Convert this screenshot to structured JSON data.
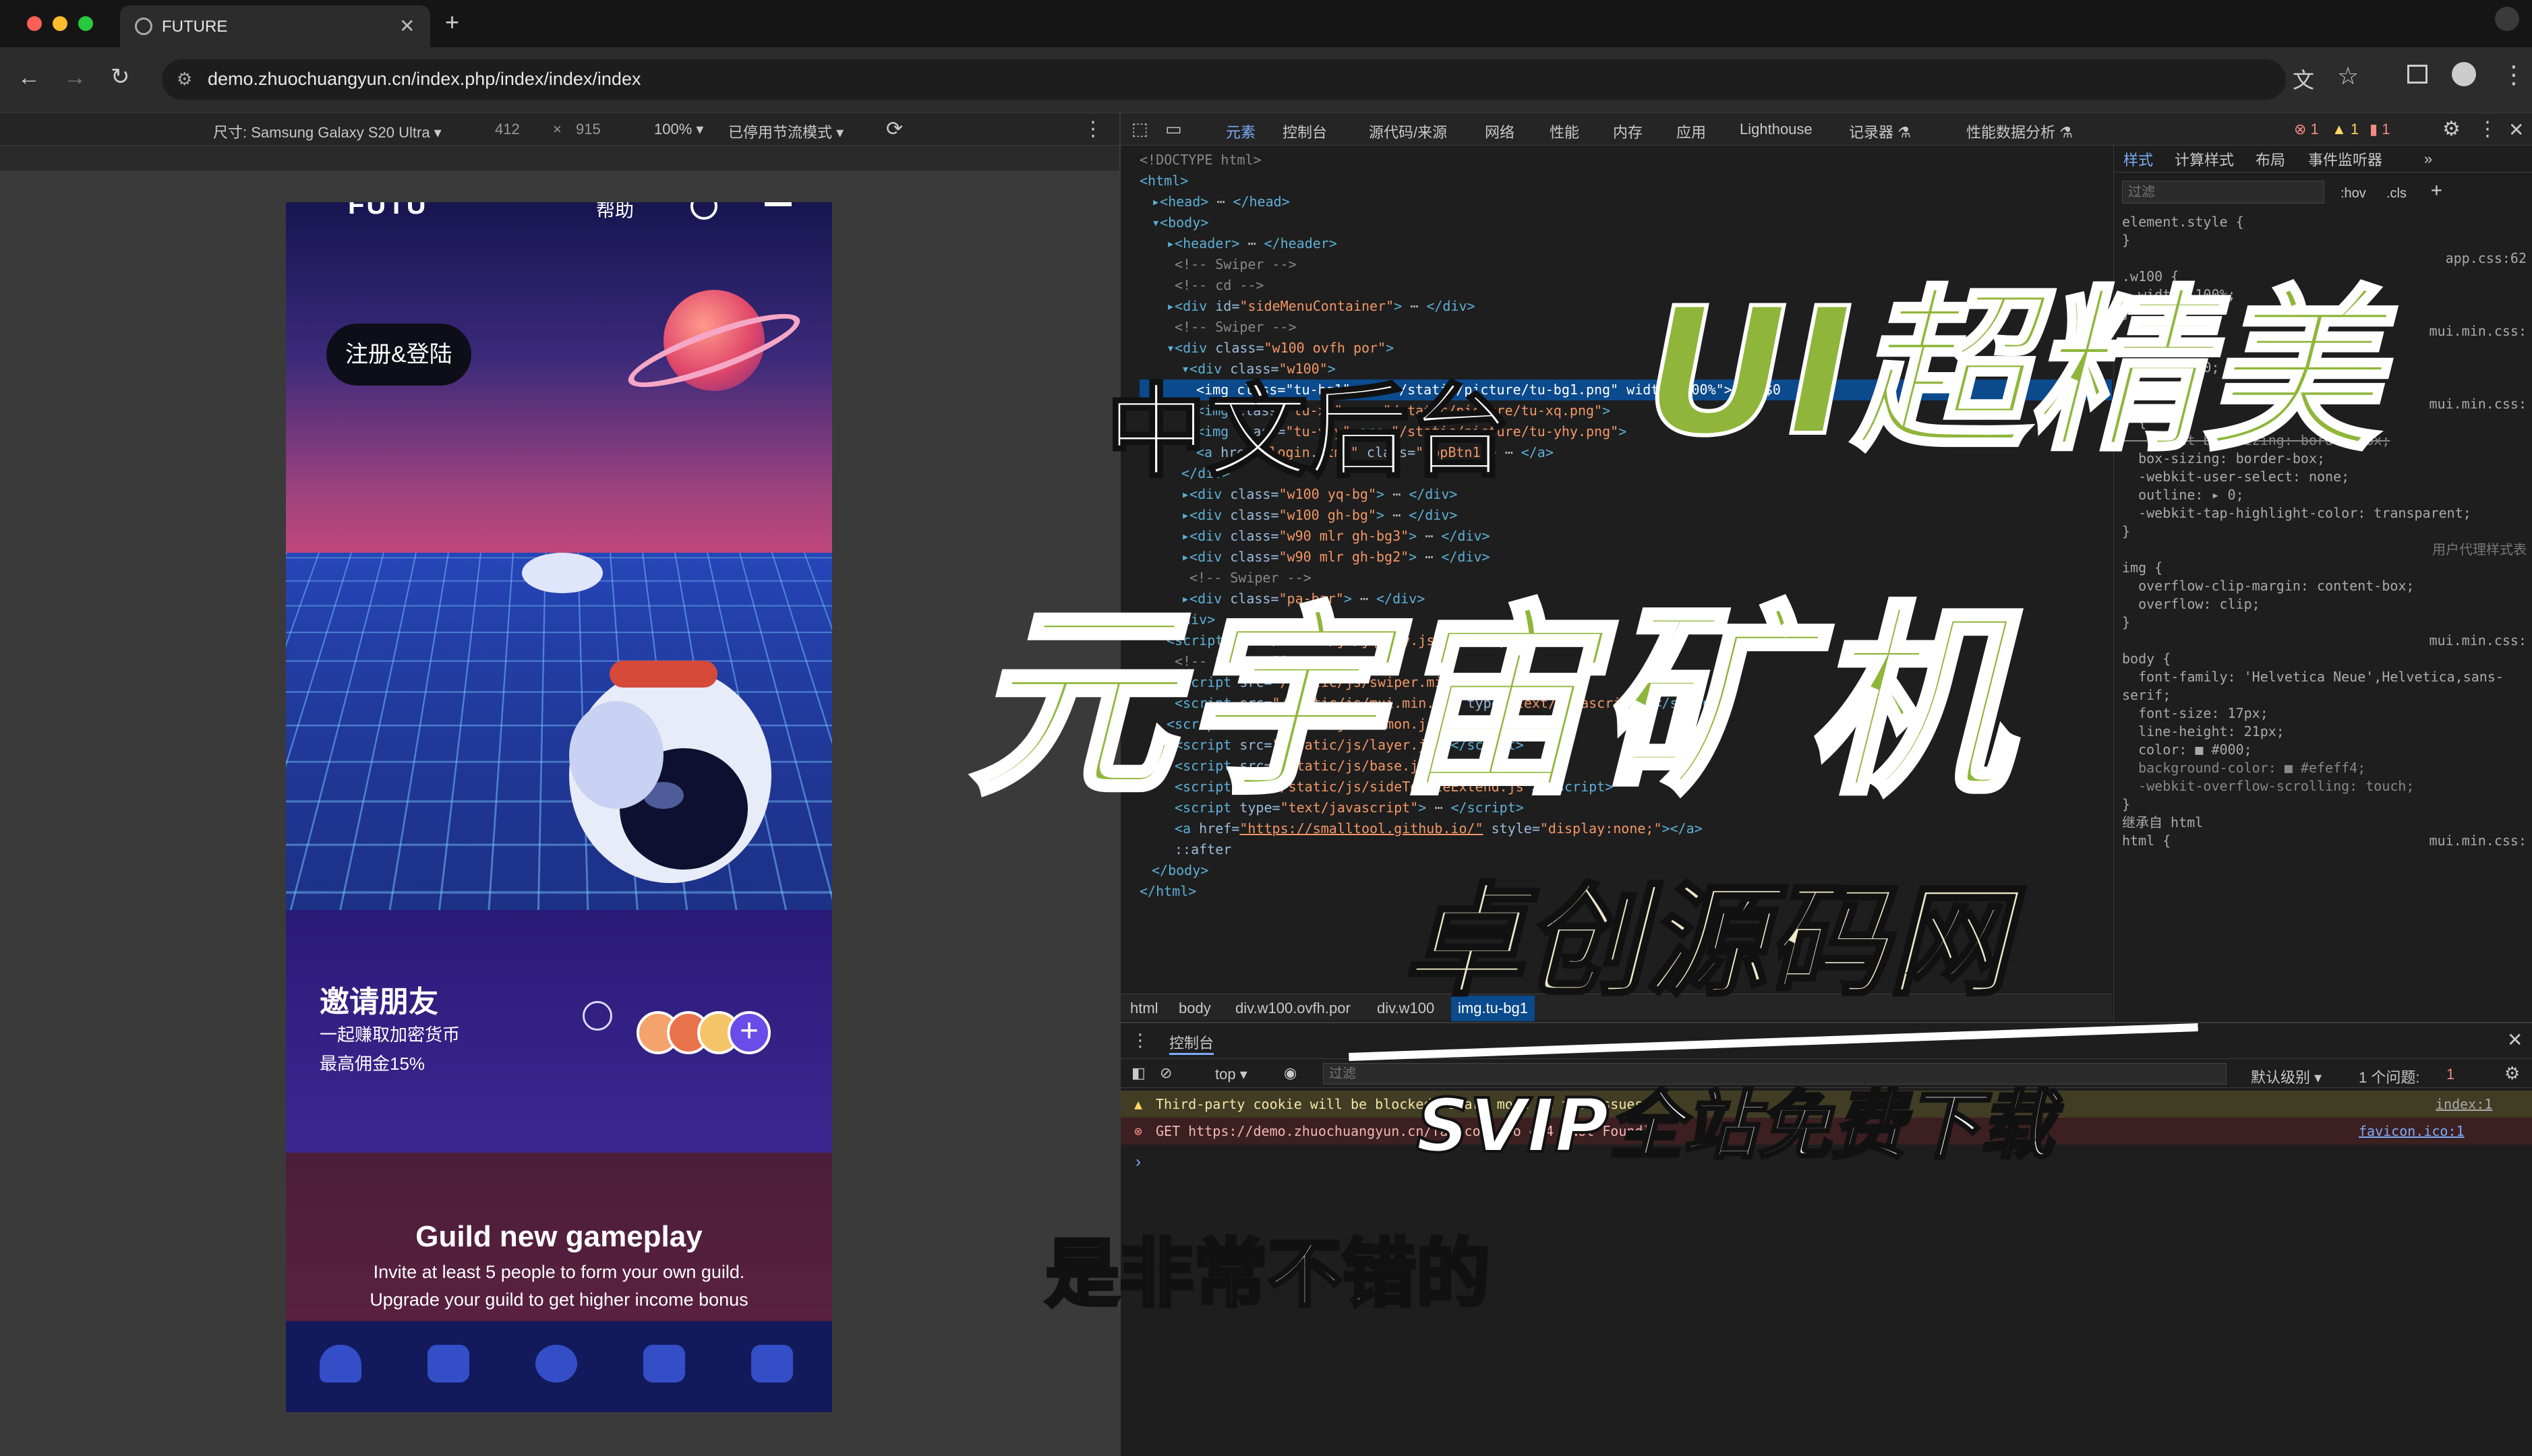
{
  "browser": {
    "tab_title": "FUTURE",
    "url": "demo.zhuochuangyun.cn/index.php/index/index/index"
  },
  "device_toolbar": {
    "device": "尺寸: Samsung Galaxy S20 Ultra ▾",
    "width": "412",
    "times": "×",
    "height": "915",
    "zoom": "100% ▾",
    "throttle": "已停用节流模式 ▾"
  },
  "phone": {
    "logo": "FUTURE",
    "header_link": "帮助",
    "register_label": "注册&登陆",
    "invite_title": "邀请朋友",
    "invite_line1": "一起赚取加密货币",
    "invite_line2": "最高佣金15%",
    "guild_title": "Guild new gameplay",
    "guild_line1": "Invite at least 5 people to form your own guild.",
    "guild_line2": "Upgrade your guild to get higher income bonus"
  },
  "devtools": {
    "tabs": [
      "元素",
      "控制台",
      "源代码/来源",
      "网络",
      "性能",
      "内存",
      "应用",
      "Lighthouse",
      "记录器 ⚗",
      "性能数据分析 ⚗"
    ],
    "errors": "1",
    "warnings": "1",
    "issues": "1",
    "styles_tabs": [
      "样式",
      "计算样式",
      "布局",
      "事件监听器"
    ],
    "filter_placeholder": "过滤",
    "hov": ":hov",
    "cls": ".cls",
    "breadcrumbs": [
      "html",
      "body",
      "div.w100.ovfh.por",
      "div.w100",
      "img.tu-bg1"
    ],
    "console_title": "控制台",
    "console_context": "top ▾",
    "console_filter": "过滤",
    "console_level": "默认级别 ▾",
    "console_issues": "1 个问题:",
    "console_issue_count": "1",
    "console_msg1": "Third-party cookie will be blocked. Learn more in the Issues",
    "console_msg1_src": "index:1",
    "console_msg2": "GET https://demo.zhuochuangyun.cn/favicon.ico 404 (Not Found)",
    "console_msg2_src": "favicon.ico:1"
  },
  "overlay": {
    "line1a": "中文后台",
    "line1b": "UI超精美",
    "line2": "元宇宙矿机",
    "line3": "卓创源码网",
    "line4": "SVIP全站免费下载",
    "subtitle": "是非常不错的"
  },
  "colors": {
    "accent_green": "#8fb63a",
    "cream": "#efe7c8"
  }
}
